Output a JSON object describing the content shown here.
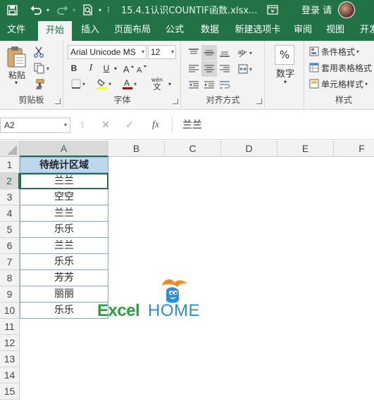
{
  "titlebar": {
    "filename": "15.4.1认识COUNTIF函数.xlsx...",
    "login": "登录 请"
  },
  "tabs": [
    "文件",
    "开始",
    "插入",
    "页面布局",
    "公式",
    "数据",
    "新建选项卡",
    "审阅",
    "视图",
    "开发"
  ],
  "active_tab": "开始",
  "ribbon": {
    "clipboard": {
      "paste_label": "粘贴",
      "group_label": "剪贴板"
    },
    "font": {
      "font_name": "Arial Unicode MS",
      "font_size": "12",
      "bold": "B",
      "italic": "I",
      "underline": "U",
      "font_color_glyph": "A",
      "wen_label": "wén",
      "wen_char": "文",
      "group_label": "字体",
      "font_color": "#c00000"
    },
    "alignment": {
      "group_label": "对齐方式"
    },
    "number": {
      "percent": "%",
      "label": "数字"
    },
    "styles": {
      "conditional_format": "条件格式",
      "table_format": "套用表格格式",
      "cell_styles": "单元格样式",
      "group_label": "样式"
    }
  },
  "formula_bar": {
    "name_box": "A2",
    "cancel": "✕",
    "enter": "✓",
    "fx": "fx",
    "content": "兰兰"
  },
  "sheet": {
    "columns": [
      "A",
      "B",
      "C",
      "D",
      "E",
      "F"
    ],
    "rows": [
      "1",
      "2",
      "3",
      "4",
      "5",
      "6",
      "7",
      "8",
      "9",
      "10",
      "11",
      "12",
      "13",
      "14",
      "15"
    ],
    "header": "待统计区域",
    "values": [
      "兰兰",
      "空空",
      "兰兰",
      "乐乐",
      "兰兰",
      "乐乐",
      "芳芳",
      "丽丽",
      "乐乐"
    ],
    "active_cell": "A2"
  },
  "logo": {
    "excel": "Excel",
    "home": "HOME"
  },
  "colors": {
    "brand_green": "#217346",
    "header_fill": "#bdd7ee",
    "table_border": "#7aa7d6"
  }
}
